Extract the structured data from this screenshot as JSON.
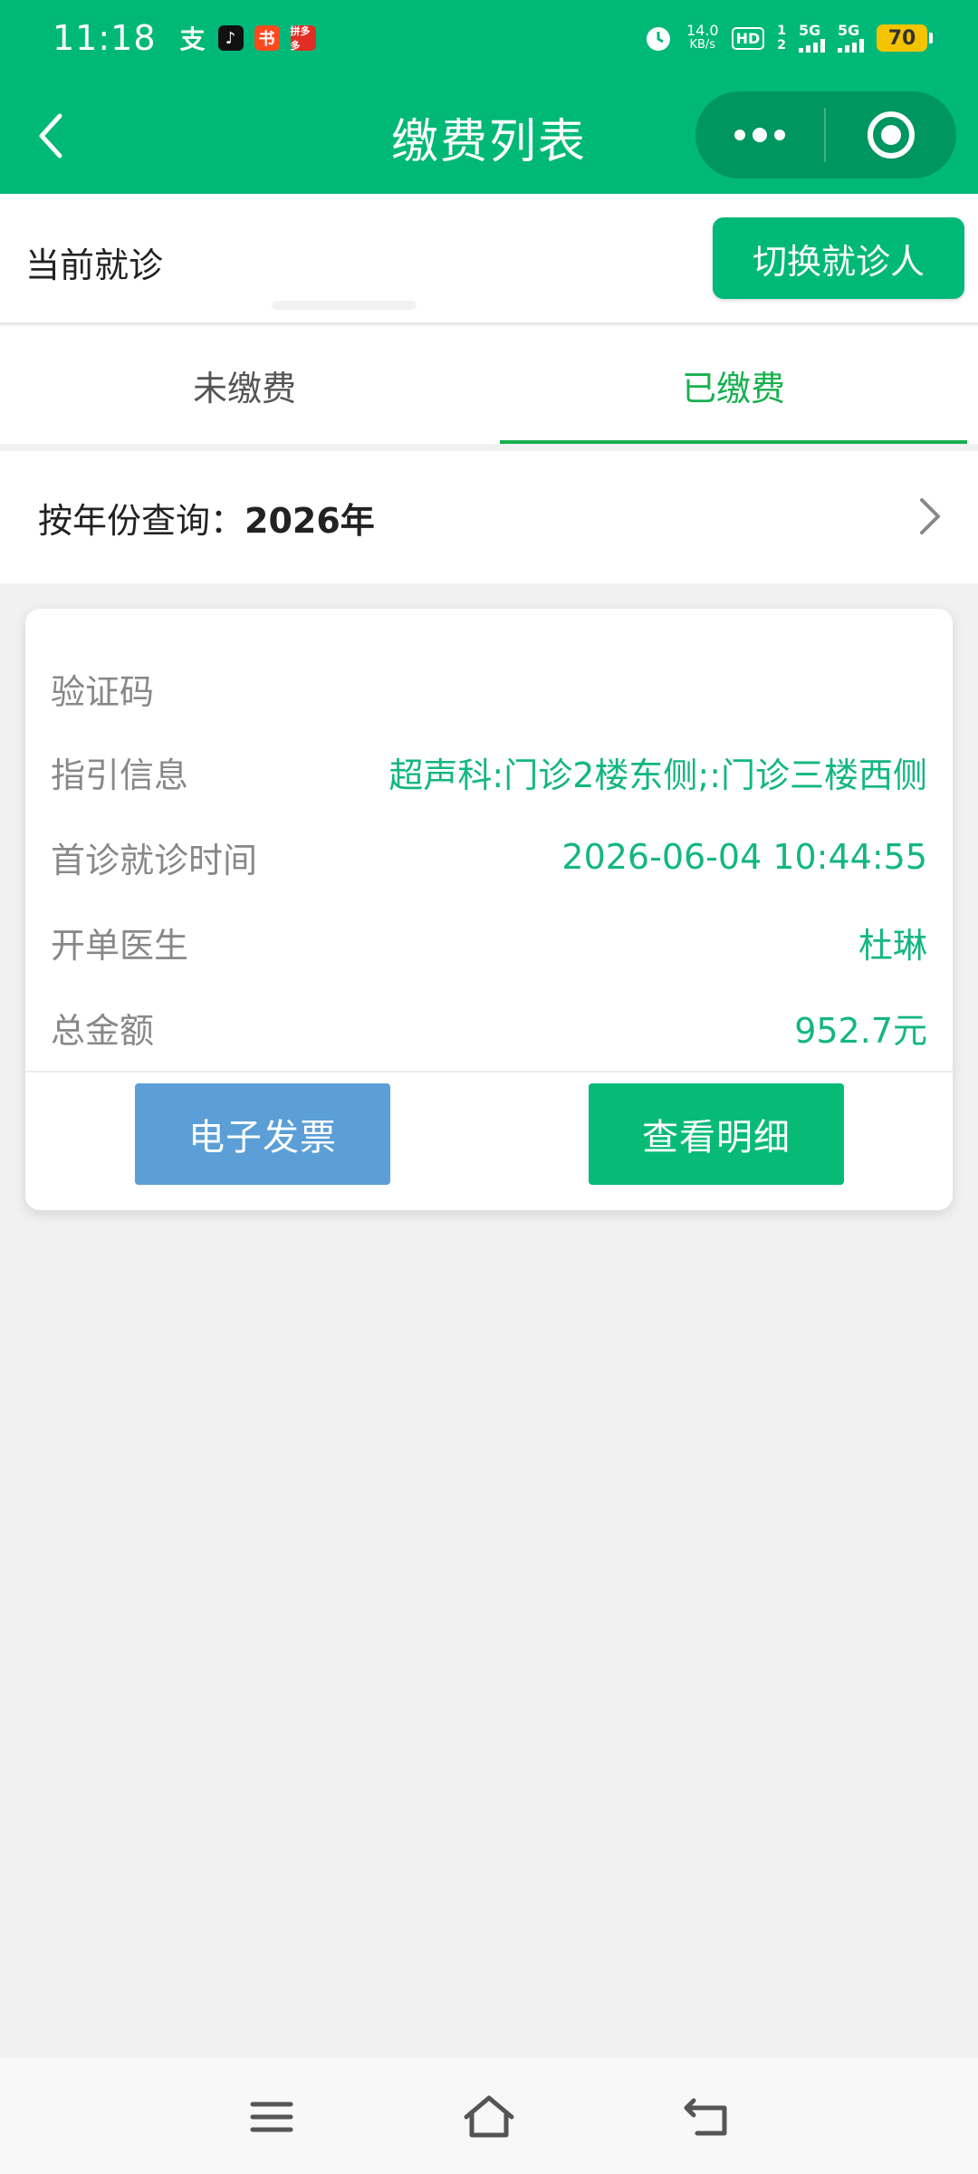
{
  "status_bar": {
    "time": "11:18",
    "apps": [
      "alipay-icon",
      "tiktok-icon",
      "xiaohongshu-icon",
      "pinduoduo-icon"
    ],
    "pdd_text": "拼多多",
    "net_speed_value": "14.0",
    "net_speed_unit": "KB/s",
    "hd_label": "HD",
    "sim1": "1",
    "sim2": "2",
    "net1": "5G",
    "net2": "5G",
    "battery": "70"
  },
  "nav": {
    "title": "缴费列表"
  },
  "patient": {
    "label": "当前就诊",
    "switch_label": "切换就诊人"
  },
  "tabs": [
    {
      "label": "未缴费",
      "active": false
    },
    {
      "label": "已缴费",
      "active": true
    }
  ],
  "filter": {
    "year_label": "按年份查询：",
    "year_value": "2026年"
  },
  "record": {
    "verify_label": "验证码",
    "verify_value": "",
    "guide_label": "指引信息",
    "guide_value": "超声科:门诊2楼东侧;:门诊三楼西侧",
    "visit_time_label": "首诊就诊时间",
    "visit_time_value": "2026-06-04 10:44:55",
    "doctor_label": "开单医生",
    "doctor_value": "杜琳",
    "amount_label": "总金额",
    "amount_value": "952.7元",
    "invoice_button": "电子发票",
    "detail_button": "查看明细"
  },
  "colors": {
    "brand": "#00b877",
    "tab_active": "#18b04f",
    "value_text": "#13b682",
    "invoice_button": "#5b9fd6",
    "detail_button": "#07bb77"
  }
}
